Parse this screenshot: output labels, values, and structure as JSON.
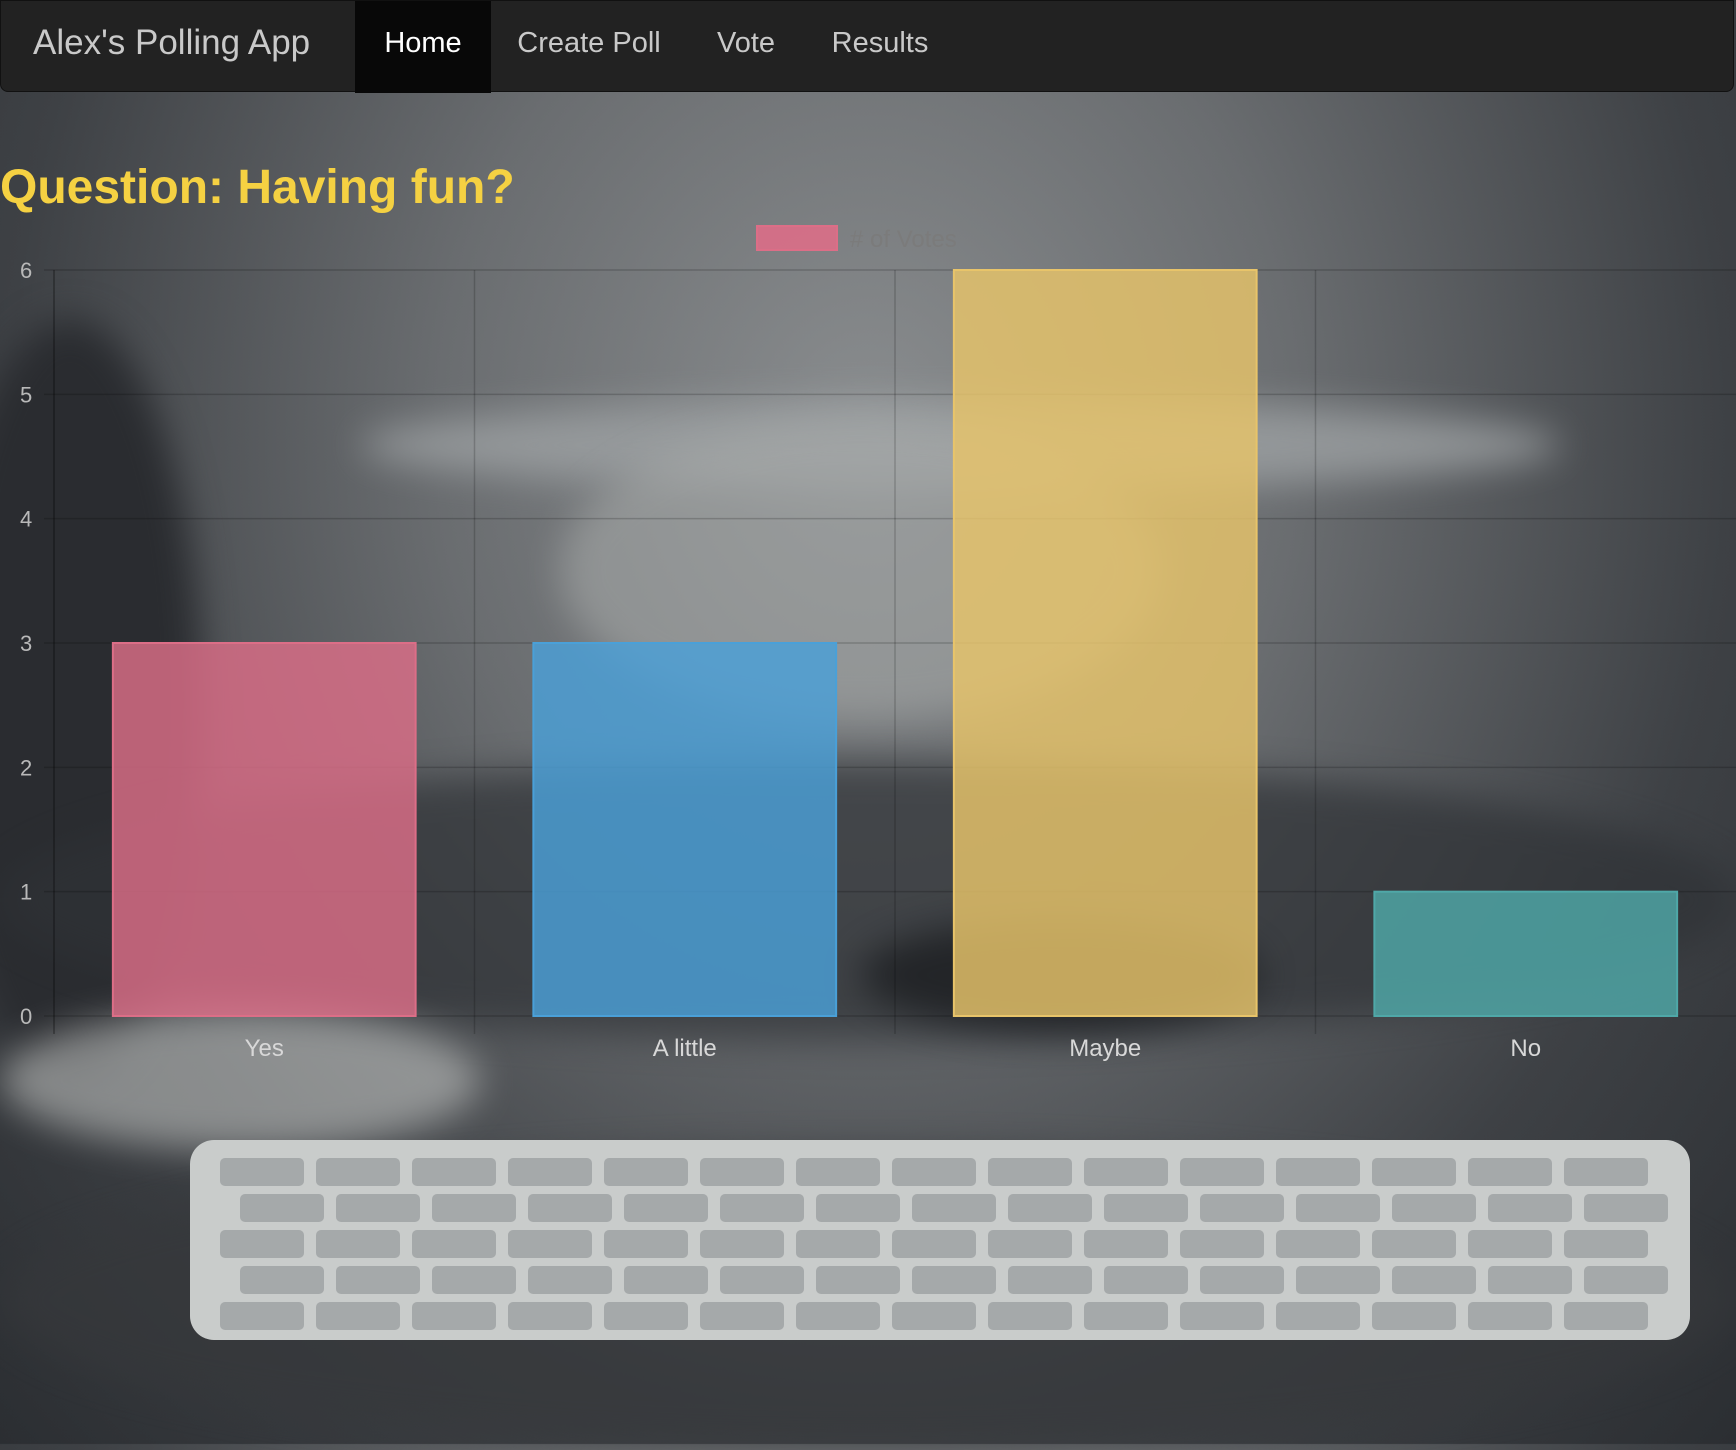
{
  "navbar": {
    "brand": "Alex's Polling App",
    "items": [
      {
        "label": "Home",
        "active": true
      },
      {
        "label": "Create Poll",
        "active": false
      },
      {
        "label": "Vote",
        "active": false
      },
      {
        "label": "Results",
        "active": false
      }
    ]
  },
  "main": {
    "question_prefix": "Question:",
    "question_text": "Having fun?"
  },
  "colors": {
    "question": "#f5d142",
    "navbar": "#222222",
    "nav_active": "#080808"
  },
  "chart_data": {
    "type": "bar",
    "categories": [
      "Yes",
      "A little",
      "Maybe",
      "No"
    ],
    "series": [
      {
        "name": "# of Votes",
        "values": [
          3,
          3,
          6,
          1
        ]
      }
    ],
    "colors": [
      "#dc6e87",
      "#4aa0d8",
      "#e8c46a",
      "#4fa8a8"
    ],
    "ylim": [
      0,
      6
    ],
    "yticks": [
      0,
      1,
      2,
      3,
      4,
      5,
      6
    ],
    "legend": "top-center",
    "grid": true
  }
}
